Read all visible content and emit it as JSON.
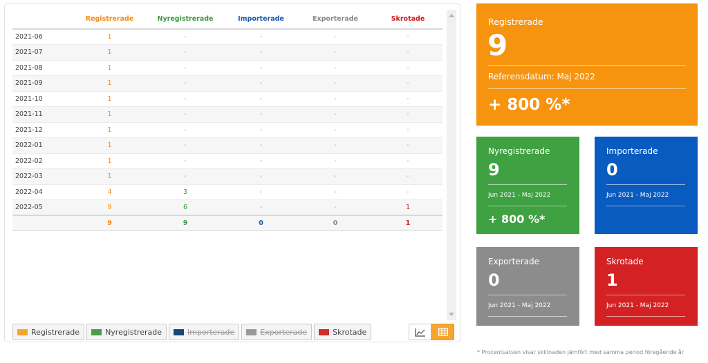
{
  "table": {
    "headers": [
      {
        "label": "",
        "color": "#444444"
      },
      {
        "label": "Registrerade",
        "color": "#f28c1a"
      },
      {
        "label": "Nyregistrerade",
        "color": "#3a9a3a"
      },
      {
        "label": "Importerade",
        "color": "#1a5aaa"
      },
      {
        "label": "Exporterade",
        "color": "#8a8a8a"
      },
      {
        "label": "Skrotade",
        "color": "#cc1f1f"
      }
    ],
    "rows": [
      [
        "2021-06",
        "1",
        "-",
        "-",
        "-",
        "-"
      ],
      [
        "2021-07",
        "1",
        "-",
        "-",
        "-",
        "-"
      ],
      [
        "2021-08",
        "1",
        "-",
        "-",
        "-",
        "-"
      ],
      [
        "2021-09",
        "1",
        "-",
        "-",
        "-",
        "-"
      ],
      [
        "2021-10",
        "1",
        "-",
        "-",
        "-",
        "-"
      ],
      [
        "2021-11",
        "1",
        "-",
        "-",
        "-",
        "-"
      ],
      [
        "2021-12",
        "1",
        "-",
        "-",
        "-",
        "-"
      ],
      [
        "2022-01",
        "1",
        "-",
        "-",
        "-",
        "-"
      ],
      [
        "2022-02",
        "1",
        "-",
        "-",
        "-",
        "-"
      ],
      [
        "2022-03",
        "1",
        "-",
        "-",
        "-",
        "-"
      ],
      [
        "2022-04",
        "4",
        "3",
        "-",
        "-",
        "-"
      ],
      [
        "2022-05",
        "9",
        "6",
        "-",
        "-",
        "1"
      ]
    ],
    "totals": [
      "",
      "9",
      "9",
      "0",
      "0",
      "1"
    ]
  },
  "legend": [
    {
      "label": "Registrerade",
      "color": "#f7a531",
      "active": true
    },
    {
      "label": "Nyregistrerade",
      "color": "#4a9e4a",
      "active": true
    },
    {
      "label": "Importerade",
      "color": "#17467e",
      "active": false
    },
    {
      "label": "Exporterade",
      "color": "#999999",
      "active": false
    },
    {
      "label": "Skrotade",
      "color": "#d42a2a",
      "active": true
    }
  ],
  "view_toggle": {
    "chart_icon": "line-chart-icon",
    "table_icon": "table-grid-icon",
    "active": "table"
  },
  "cards": {
    "registrerade": {
      "title": "Registrerade",
      "value": "9",
      "ref_label": "Referensdatum: Maj 2022",
      "pct": "+ 800 %*",
      "color": "#f7940f"
    },
    "nyregistrerade": {
      "title": "Nyregistrerade",
      "value": "9",
      "period": "Jun 2021 - Maj 2022",
      "pct": "+ 800 %*",
      "color": "#3fa142"
    },
    "importerade": {
      "title": "Importerade",
      "value": "0",
      "period": "Jun 2021 - Maj 2022",
      "color": "#0a5bc0"
    },
    "exporterade": {
      "title": "Exporterade",
      "value": "0",
      "period": "Jun 2021 - Maj 2022",
      "color": "#8c8c8c"
    },
    "skrotade": {
      "title": "Skrotade",
      "value": "1",
      "period": "Jun 2021 - Maj 2022",
      "color": "#d42224"
    }
  },
  "footnote": "* Procentsatsen visar skillnaden jämfört med samma period föregående år"
}
